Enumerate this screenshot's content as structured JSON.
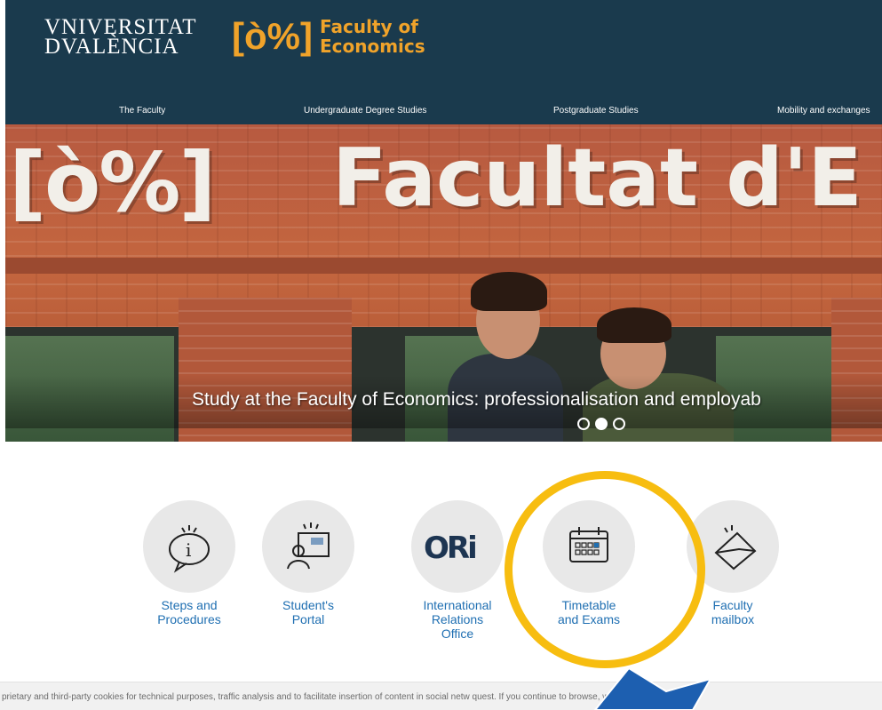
{
  "header": {
    "university_line1": "VNIVERSITAT",
    "university_line2": "DVALÈNCIA",
    "faculty_symbol": "[ò%]",
    "faculty_line1": "Faculty of",
    "faculty_line2": "Economics"
  },
  "nav": {
    "items": [
      {
        "label": "The Faculty"
      },
      {
        "label": "Undergraduate Degree Studies"
      },
      {
        "label": "Postgraduate Studies"
      },
      {
        "label": "Mobility and exchanges"
      }
    ]
  },
  "hero": {
    "sign_symbol": "[ò%]",
    "sign_text": "Facultat d'E",
    "caption": "Study at the Faculty of Economics: professionalisation and employab",
    "slides": 3,
    "active_slide": 2
  },
  "quick_links": [
    {
      "icon": "info-speech-bubble-icon",
      "line1": "Steps and",
      "line2": "Procedures",
      "line3": ""
    },
    {
      "icon": "student-portal-icon",
      "line1": "Student's",
      "line2": "Portal",
      "line3": ""
    },
    {
      "icon": "ori-logo-icon",
      "line1": "International",
      "line2": "Relations",
      "line3": "Office"
    },
    {
      "icon": "calendar-icon",
      "line1": "Timetable",
      "line2": "and Exams",
      "line3": ""
    },
    {
      "icon": "envelope-icon",
      "line1": "Faculty",
      "line2": "mailbox",
      "line3": ""
    }
  ],
  "cookie": {
    "text": "prietary and third-party cookies for technical purposes, traffic analysis and to facilitate insertion of content in social netw                   quest. If you continue to browse, we"
  },
  "colors": {
    "header_bg": "#1a3a4d",
    "accent": "#f0a32a",
    "link": "#1f6fb2",
    "highlight": "#f7bd10",
    "arrow": "#1d5fb0"
  }
}
